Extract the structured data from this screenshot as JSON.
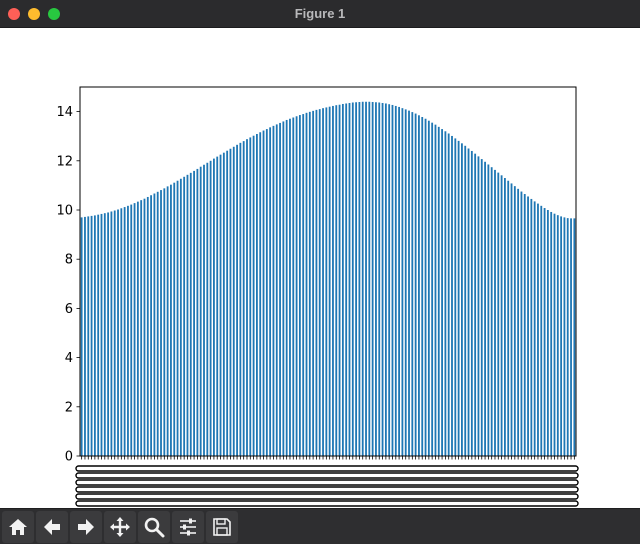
{
  "window": {
    "title": "Figure 1"
  },
  "toolbar": {
    "buttons": [
      {
        "name": "home-icon",
        "action": "Home"
      },
      {
        "name": "back-arrow-icon",
        "action": "Back"
      },
      {
        "name": "forward-arrow-icon",
        "action": "Forward"
      },
      {
        "name": "pan-icon",
        "action": "Pan"
      },
      {
        "name": "zoom-icon",
        "action": "Zoom"
      },
      {
        "name": "configure-subplots-icon",
        "action": "Configure subplots"
      },
      {
        "name": "save-icon",
        "action": "Save"
      }
    ]
  },
  "chart_data": {
    "type": "bar",
    "title": "",
    "xlabel": "",
    "ylabel": "",
    "ylim": [
      0,
      15
    ],
    "yticks": [
      0,
      2,
      4,
      6,
      8,
      10,
      12,
      14
    ],
    "bar_color": "#1f77b4",
    "grid": false,
    "legend": "none",
    "category_count": 150,
    "category_labels_note": "x tick labels overlap into an illegible black band",
    "values": [
      9.7,
      9.72,
      9.74,
      9.76,
      9.78,
      9.81,
      9.84,
      9.87,
      9.9,
      9.94,
      9.98,
      10.02,
      10.07,
      10.12,
      10.17,
      10.22,
      10.28,
      10.34,
      10.4,
      10.46,
      10.53,
      10.6,
      10.67,
      10.74,
      10.81,
      10.88,
      10.96,
      11.03,
      11.11,
      11.19,
      11.27,
      11.35,
      11.43,
      11.51,
      11.59,
      11.67,
      11.76,
      11.84,
      11.92,
      12.0,
      12.09,
      12.17,
      12.25,
      12.33,
      12.41,
      12.49,
      12.57,
      12.65,
      12.73,
      12.8,
      12.88,
      12.95,
      13.02,
      13.09,
      13.16,
      13.23,
      13.29,
      13.36,
      13.42,
      13.48,
      13.54,
      13.6,
      13.66,
      13.71,
      13.76,
      13.81,
      13.86,
      13.9,
      13.95,
      13.99,
      14.03,
      14.07,
      14.1,
      14.14,
      14.17,
      14.2,
      14.23,
      14.26,
      14.28,
      14.31,
      14.33,
      14.35,
      14.37,
      14.38,
      14.39,
      14.4,
      14.4,
      14.4,
      14.39,
      14.38,
      14.37,
      14.35,
      14.33,
      14.3,
      14.27,
      14.23,
      14.19,
      14.14,
      14.09,
      14.04,
      13.98,
      13.92,
      13.85,
      13.78,
      13.71,
      13.63,
      13.55,
      13.47,
      13.38,
      13.29,
      13.2,
      13.11,
      13.01,
      12.91,
      12.81,
      12.71,
      12.61,
      12.5,
      12.4,
      12.29,
      12.18,
      12.07,
      11.96,
      11.85,
      11.74,
      11.63,
      11.52,
      11.41,
      11.3,
      11.19,
      11.08,
      10.97,
      10.86,
      10.75,
      10.65,
      10.55,
      10.45,
      10.35,
      10.26,
      10.17,
      10.08,
      10.0,
      9.92,
      9.85,
      9.79,
      9.74,
      9.7,
      9.67,
      9.66,
      9.66
    ]
  }
}
